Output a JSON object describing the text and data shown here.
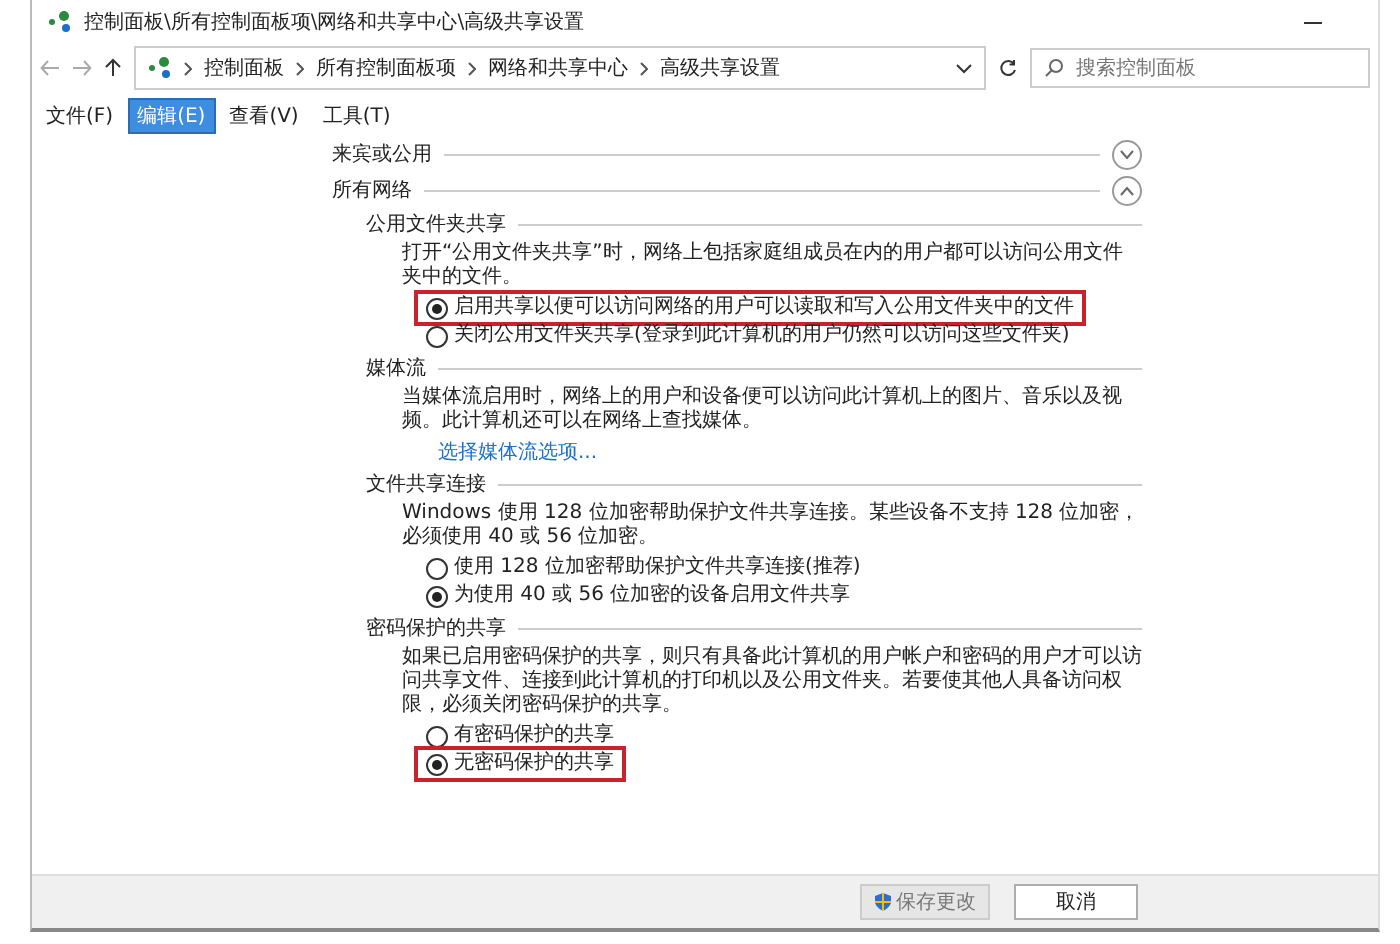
{
  "window": {
    "title": "控制面板\\所有控制面板项\\网络和共享中心\\高级共享设置"
  },
  "breadcrumb": [
    "控制面板",
    "所有控制面板项",
    "网络和共享中心",
    "高级共享设置"
  ],
  "search": {
    "placeholder": "搜索控制面板"
  },
  "menu": [
    {
      "label": "文件(F)",
      "selected": false
    },
    {
      "label": "编辑(E)",
      "selected": true
    },
    {
      "label": "查看(V)",
      "selected": false
    },
    {
      "label": "工具(T)",
      "selected": false
    }
  ],
  "profiles": [
    {
      "title": "来宾或公用",
      "expanded": false
    },
    {
      "title": "所有网络",
      "expanded": true,
      "groups": [
        {
          "title": "公用文件夹共享",
          "description": "打开“公用文件夹共享”时，网络上包括家庭组成员在内的用户都可以访问公用文件夹中的文件。",
          "options": [
            {
              "label": "启用共享以便可以访问网络的用户可以读取和写入公用文件夹中的文件",
              "selected": true,
              "highlighted": true
            },
            {
              "label": "关闭公用文件夹共享(登录到此计算机的用户仍然可以访问这些文件夹)",
              "selected": false,
              "highlighted": false
            }
          ]
        },
        {
          "title": "媒体流",
          "description": "当媒体流启用时，网络上的用户和设备便可以访问此计算机上的图片、音乐以及视频。此计算机还可以在网络上查找媒体。",
          "link": "选择媒体流选项..."
        },
        {
          "title": "文件共享连接",
          "description": "Windows 使用 128 位加密帮助保护文件共享连接。某些设备不支持 128 位加密，必须使用 40 或 56 位加密。",
          "options": [
            {
              "label": "使用 128 位加密帮助保护文件共享连接(推荐)",
              "selected": false,
              "highlighted": false
            },
            {
              "label": "为使用 40 或 56 位加密的设备启用文件共享",
              "selected": true,
              "highlighted": false
            }
          ]
        },
        {
          "title": "密码保护的共享",
          "description": "如果已启用密码保护的共享，则只有具备此计算机的用户帐户和密码的用户才可以访问共享文件、连接到此计算机的打印机以及公用文件夹。若要使其他人具备访问权限，必须关闭密码保护的共享。",
          "options": [
            {
              "label": "有密码保护的共享",
              "selected": false,
              "highlighted": false
            },
            {
              "label": "无密码保护的共享",
              "selected": true,
              "highlighted": true
            }
          ]
        }
      ]
    }
  ],
  "footer": {
    "buttons": [
      {
        "label": "保存更改",
        "kind": "shield"
      },
      {
        "label": "取消",
        "kind": "plain"
      }
    ]
  }
}
